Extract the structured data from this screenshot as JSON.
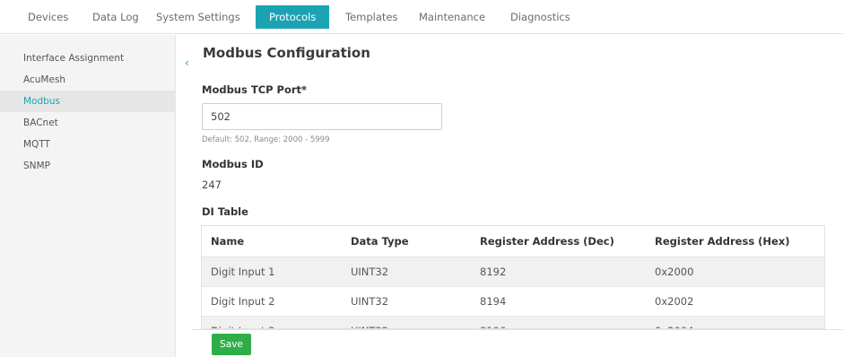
{
  "tabs": [
    {
      "label": "Devices",
      "active": false
    },
    {
      "label": "Data Log",
      "active": false
    },
    {
      "label": "System Settings",
      "active": false
    },
    {
      "label": "Protocols",
      "active": true
    },
    {
      "label": "Templates",
      "active": false
    },
    {
      "label": "Maintenance",
      "active": false
    },
    {
      "label": "Diagnostics",
      "active": false
    }
  ],
  "sidebar": {
    "items": [
      {
        "label": "Interface Assignment",
        "active": false
      },
      {
        "label": "AcuMesh",
        "active": false
      },
      {
        "label": "Modbus",
        "active": true
      },
      {
        "label": "BACnet",
        "active": false
      },
      {
        "label": "MQTT",
        "active": false
      },
      {
        "label": "SNMP",
        "active": false
      }
    ]
  },
  "main": {
    "title": "Modbus Configuration",
    "tcp_port_label": "Modbus TCP Port*",
    "tcp_port_value": "502",
    "tcp_port_hint": "Default: 502, Range: 2000 - 5999",
    "modbus_id_label": "Modbus ID",
    "modbus_id_value": "247",
    "di_table_label": "DI Table",
    "di_table": {
      "headers": [
        "Name",
        "Data Type",
        "Register Address (Dec)",
        "Register Address (Hex)"
      ],
      "rows": [
        [
          "Digit Input 1",
          "UINT32",
          "8192",
          "0x2000"
        ],
        [
          "Digit Input 2",
          "UINT32",
          "8194",
          "0x2002"
        ],
        [
          "Digit Input 3",
          "UINT32",
          "8196",
          "0x2004"
        ]
      ]
    },
    "save_label": "Save"
  },
  "colors": {
    "accent": "#1ba3b3",
    "save": "#2fae48"
  },
  "icons": {
    "collapse": "chevron-left-icon"
  }
}
